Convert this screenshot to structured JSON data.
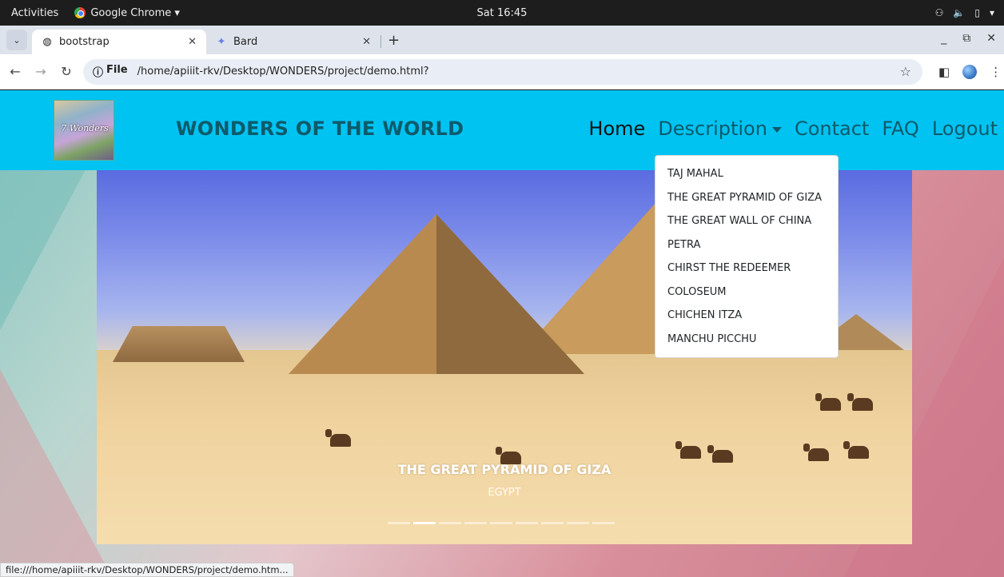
{
  "os_bar": {
    "activities": "Activities",
    "app_name": "Google Chrome ▾",
    "clock": "Sat 16:45"
  },
  "tabs": [
    {
      "title": "bootstrap",
      "icon": "globe-icon",
      "active": true
    },
    {
      "title": "Bard",
      "icon": "bard-sparkle-icon",
      "active": false
    }
  ],
  "address_bar": {
    "info_label": "File",
    "url": "/home/apiiit-rkv/Desktop/WONDERS/project/demo.html?"
  },
  "page": {
    "brand_logo_text": "7 Wonders",
    "brand_title": "WONDERS OF THE WORLD",
    "nav": {
      "home": "Home",
      "description": "Description",
      "contact": "Contact",
      "faq": "FAQ",
      "logout": "Logout"
    },
    "dropdown_items": [
      "TAJ MAHAL",
      "THE GREAT PYRAMID OF GIZA",
      "THE GREAT WALL OF CHINA",
      "PETRA",
      "CHIRST THE REDEEMER",
      "COLOSEUM",
      "CHICHEN ITZA",
      "MANCHU PICCHU"
    ],
    "carousel": {
      "caption_title": "THE GREAT PYRAMID OF GIZA",
      "caption_sub": "EGYPT",
      "slide_count": 9,
      "active_index": 1
    }
  },
  "status_bar": "file:///home/apiiit-rkv/Desktop/WONDERS/project/demo.htm...",
  "colors": {
    "navbar": "#00c3f2",
    "nav_text": "#0d5a6b"
  }
}
